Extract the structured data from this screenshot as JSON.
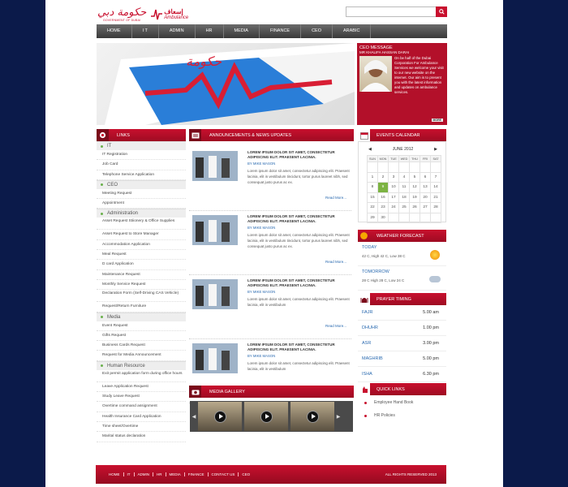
{
  "header": {
    "gov_logo_ar": "حكومة دبي",
    "gov_logo_en": "GOVERNMENT OF DUBAI",
    "amb_logo_ar": "إسعاف",
    "amb_logo_en": "Ambulance",
    "search_placeholder": ""
  },
  "nav": [
    "HOME",
    "I T",
    "ADMIN",
    "HR",
    "MEDIA",
    "FINANCE",
    "CEO",
    "ARABIC"
  ],
  "ceo": {
    "heading": "CEO MESSAGE",
    "name": "MR KHALIFA HASSAN DARAI",
    "text": "On be half of the Dubai Corporation For Ambulance Services we welcome your visit to our new website on the internet. Our aim is to present you with the latest information and updates on ambulance services.",
    "more": "MORE"
  },
  "links": {
    "title": "LINKS",
    "it_title": "IT",
    "it": [
      "IT Registration",
      "Job Card",
      "Telephone Service Application"
    ],
    "ceo_title": "CEO",
    "ceo": [
      "Meeting Request",
      "Appointment"
    ],
    "admin_title": "Administration",
    "admin": [
      "Asset Request Stiionery & Office Supplies",
      "Asset Request to Store Manager",
      "Accommodation Application",
      "Meal Request",
      "D card Application",
      "Maintenance Request",
      "Monthly Service Request",
      "Declaration Form (Self-Driving CAS Vehicle)",
      "Request/Return Furniture"
    ],
    "media_title": "Media",
    "media": [
      "Event Request",
      "Gifts Request",
      "Business Cards Request",
      "Request for Media Announcement"
    ],
    "hr_title": "Human Resource",
    "hr": [
      "Exit permit application form during office hours",
      "Leave Application Request",
      "Study Leave Request",
      "Overtime command assignment",
      "Health Insurance Card Application",
      "Time sheet/Overtime",
      "Marital status declaration"
    ]
  },
  "announcements": {
    "title": "ANNOUNCEMENTS & NEWS UPDATES",
    "items": [
      {
        "title": "LOREM IPSUM DOLOR SIT AMET, CONSECTETUR ADIPISCING ELIT. PRAESENT LACINIA.",
        "by": "BY MIKE MASON",
        "body": "Lorem ipsum dolor sit amet, consectetur adipiscing elit. Praesent lacinia, elit in vestibulum tincidunt, tortor purus laoreet nibh, sed consequat justo purus ac ex.",
        "more": "Read More..."
      },
      {
        "title": "LOREM IPSUM DOLOR SIT AMET, CONSECTETUR ADIPISCING ELIT. PRAESENT LACINIA.",
        "by": "BY MIKE MASON",
        "body": "Lorem ipsum dolor sit amet, consectetur adipiscing elit. Praesent lacinia, elit in vestibulum tincidunt, tortor purus laoreet nibh, sed consequat justo purus ac ex.",
        "more": "Read More..."
      },
      {
        "title": "LOREM IPSUM DOLOR SIT AMET, CONSECTETUR ADIPISCING ELIT. PRAESENT LACINIA.",
        "by": "BY MIKE MASON",
        "body": "Lorem ipsum dolor sit amet, consectetur adipiscing elit. Praesent lacinia, elit in vestibulum",
        "more": "Read More..."
      },
      {
        "title": "LOREM IPSUM DOLOR SIT AMET, CONSECTETUR ADIPISCING ELIT. PRAESENT LACINIA.",
        "by": "BY MIKE MASON",
        "body": "Lorem ipsum dolor sit amet, consectetur adipiscing elit. Praesent lacinia, elit in vestibulum",
        "more": "Read More..."
      }
    ]
  },
  "gallery": {
    "title": "MEDIA GALLERY"
  },
  "calendar": {
    "title": "EVENTS CALENDAR",
    "month": "JUNE 2012",
    "days": [
      "SUN",
      "MON",
      "TUE",
      "WED",
      "THU",
      "FRI",
      "SAT"
    ],
    "weeks": [
      [
        "",
        "",
        "",
        "",
        "",
        "",
        ""
      ],
      [
        "1",
        "2",
        "3",
        "4",
        "5",
        "6",
        "7"
      ],
      [
        "8",
        "9",
        "10",
        "11",
        "12",
        "13",
        "14"
      ],
      [
        "15",
        "16",
        "17",
        "18",
        "19",
        "20",
        "21"
      ],
      [
        "22",
        "23",
        "24",
        "25",
        "26",
        "27",
        "28"
      ],
      [
        "29",
        "30",
        "",
        "",
        "",
        "",
        ""
      ]
    ],
    "today": "9"
  },
  "weather": {
    "title": "WEATHER FORECAST",
    "today_label": "TODAY",
    "today_temp": "42 C, High 42 C, Low 38 C",
    "tomorrow_label": "TOMORROW",
    "tomorrow_temp": "28 C High 28 C, Low 24 C"
  },
  "prayer": {
    "title": "PRAYER TIMING",
    "rows": [
      {
        "name": "FAJR",
        "time": "5.00 am"
      },
      {
        "name": "DHUHR",
        "time": "1.00 pm"
      },
      {
        "name": "ASR",
        "time": "3.00 pm"
      },
      {
        "name": "MAGHRIB",
        "time": "5.00 pm"
      },
      {
        "name": "ISHA",
        "time": "6.30 pm"
      }
    ]
  },
  "quick": {
    "title": "QUICK LINKS",
    "items": [
      "Employee Hand Book",
      "HR Policies"
    ]
  },
  "footer": {
    "nav": [
      "HOME",
      "IT",
      "ADMIN",
      "HR",
      "MEDIA",
      "FINANCE",
      "CONTACT US",
      "CEO"
    ],
    "copy": "ALL RIGHTS RESERVED 2013"
  },
  "colors": {
    "primary": "#c8102e",
    "nav": "#4a4a4a",
    "link": "#2a6ab0",
    "background": "#0b1a4a"
  }
}
